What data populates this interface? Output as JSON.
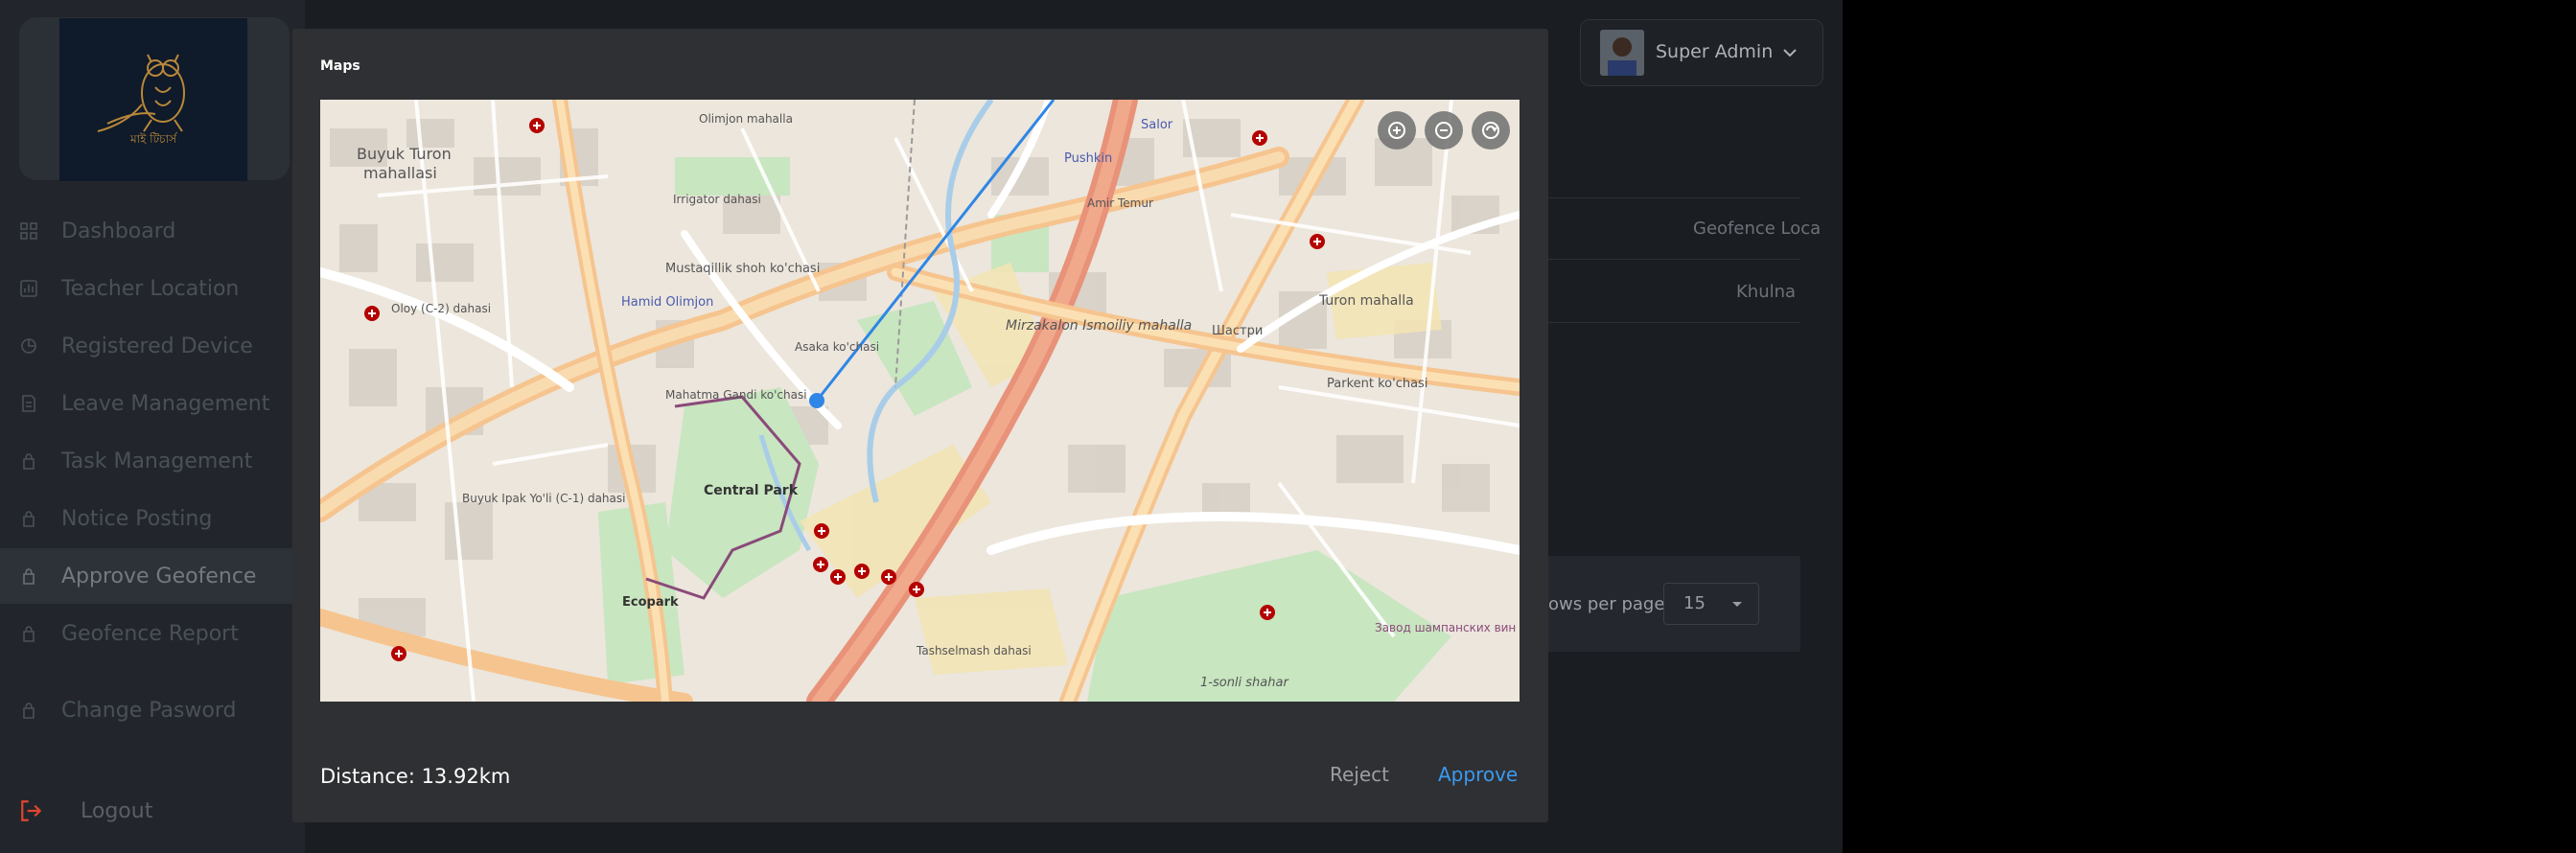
{
  "sidebar": {
    "brand_text": "মাই টিচার্স",
    "items": [
      {
        "label": "Dashboard",
        "icon": "dashboard-icon"
      },
      {
        "label": "Teacher Location",
        "icon": "location-icon"
      },
      {
        "label": "Registered Device",
        "icon": "device-icon"
      },
      {
        "label": "Leave Management",
        "icon": "leave-icon"
      },
      {
        "label": "Task Management",
        "icon": "task-icon"
      },
      {
        "label": "Notice Posting",
        "icon": "notice-icon"
      },
      {
        "label": "Approve Geofence",
        "icon": "geofence-icon"
      },
      {
        "label": "Geofence Report",
        "icon": "report-icon"
      },
      {
        "label": "Change Pasword",
        "icon": "lock-icon"
      }
    ],
    "logout_label": "Logout"
  },
  "header": {
    "user_name": "Super Admin"
  },
  "background": {
    "table_header": "Geofence Loca",
    "table_cell": "Khulna",
    "rows_per_page_label": "ows per page",
    "rows_per_page_value": "15"
  },
  "modal": {
    "title": "Maps",
    "distance": "Distance: 13.92km",
    "reject_label": "Reject",
    "approve_label": "Approve"
  },
  "map": {
    "labels": {
      "buyuk_turon": "Buyuk Turon",
      "mahallasi": "mahallasi",
      "irrigator_dahasi": "Irrigator dahasi",
      "hamid_olimjon": "Hamid Olimjon",
      "oloy": "Oloy (C-2) dahasi",
      "mirzakalon": "Mirzakalon Ismoiliy mahalla",
      "central_park": "Central Park",
      "ecopark": "Ecopark",
      "buyuk_ipak": "Buyuk Ipak Yo'li (C-1) dahasi",
      "tashselmash": "Tashselmash dahasi",
      "turon_mahalla": "Turon mahalla",
      "shastri": "Шастри",
      "pushkin": "Pushkin",
      "parkent": "Parkent ko'chasi",
      "mustaqillik": "Mustaqillik shoh ko'chasi",
      "amir_temur": "Amir Temur",
      "one_sonli_shahar": "1-sonli shahar",
      "zavod": "Завод шампанских вин",
      "salor": "Salor",
      "olimjon_top": "Olimjon mahalla",
      "mahatma": "Mahatma Gandi ko'chasi",
      "asaka": "Asaka ko'chasi"
    },
    "route_color": "#2f86e6",
    "marker_color": "#b40000"
  },
  "colors": {
    "accent": "#3b9af0",
    "logout": "#e0452f"
  }
}
